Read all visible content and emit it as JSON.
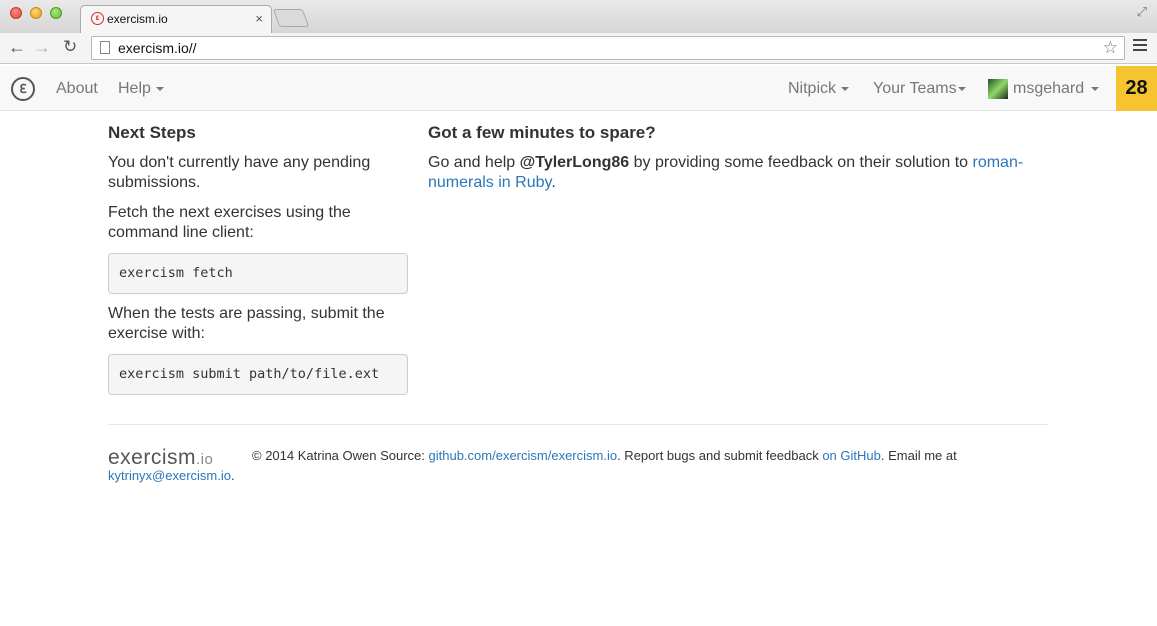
{
  "browser": {
    "tab_title": "exercism.io",
    "tab_favicon": "exercism-favicon",
    "tab_close": "×",
    "url": "exercism.io//",
    "star_icon": "☆"
  },
  "nav": {
    "about": "About",
    "help": "Help",
    "nitpick": "Nitpick",
    "your_teams": "Your Teams",
    "username": "msgehard",
    "badge_count": "28",
    "logo_glyph": "ℇ"
  },
  "next_steps": {
    "heading": "Next Steps",
    "pending": "You don't currently have any pending submissions.",
    "fetch_intro": "Fetch the next exercises using the command line client:",
    "fetch_cmd": "exercism fetch",
    "submit_intro": "When the tests are passing, submit the exercise with:",
    "submit_cmd": "exercism submit path/to/file.ext"
  },
  "spare": {
    "heading": "Got a few minutes to spare?",
    "text_before": "Go and help ",
    "user": "@TylerLong86",
    "text_middle": " by providing some feedback on their solution to ",
    "link": "roman-numerals in Ruby",
    "text_after": "."
  },
  "footer": {
    "logo_main": "exercism",
    "logo_io": ".io",
    "copyright": "© 2014 Katrina Owen Source: ",
    "source_link": "github.com/exercism/exercism.io",
    "report_text": ". Report bugs and submit feedback ",
    "github_link": "on GitHub",
    "email_text": ". Email me at",
    "email_link": "kytrinyx@exercism.io",
    "email_period": "."
  },
  "colors": {
    "link": "#2a77b8",
    "badge": "#f6c431"
  }
}
